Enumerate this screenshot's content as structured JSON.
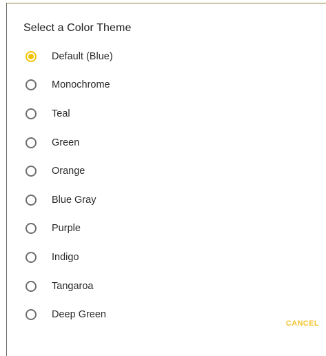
{
  "dialog": {
    "title": "Select a Color Theme",
    "options": [
      {
        "label": "Default (Blue)",
        "selected": true
      },
      {
        "label": "Monochrome",
        "selected": false
      },
      {
        "label": "Teal",
        "selected": false
      },
      {
        "label": "Green",
        "selected": false
      },
      {
        "label": "Orange",
        "selected": false
      },
      {
        "label": "Blue Gray",
        "selected": false
      },
      {
        "label": "Purple",
        "selected": false
      },
      {
        "label": "Indigo",
        "selected": false
      },
      {
        "label": "Tangaroa",
        "selected": false
      },
      {
        "label": "Deep Green",
        "selected": false
      }
    ],
    "cancel_label": "CANCEL",
    "accent_color": "#f2c200"
  }
}
